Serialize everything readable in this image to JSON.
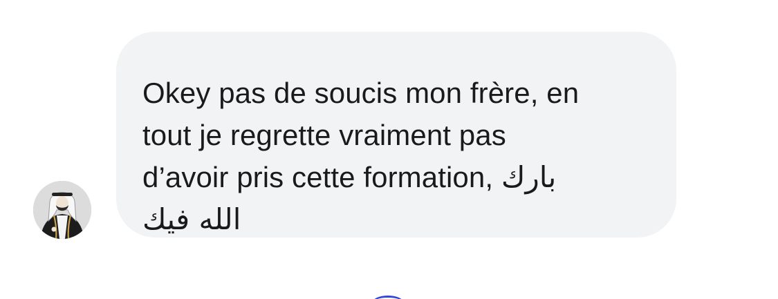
{
  "message": {
    "lines": [
      "Okey pas de soucis mon frère, en",
      "tout je regrette vraiment pas",
      "d’avoir pris cette formation,"
    ],
    "arabic_inline": "بارك",
    "arabic_line": "الله فيك"
  },
  "sender": {
    "avatar_icon": "user-avatar-illustration"
  },
  "colors": {
    "bubble": "#f2f3f5",
    "text": "#1a1a1a",
    "accent": "#2f46d6"
  }
}
